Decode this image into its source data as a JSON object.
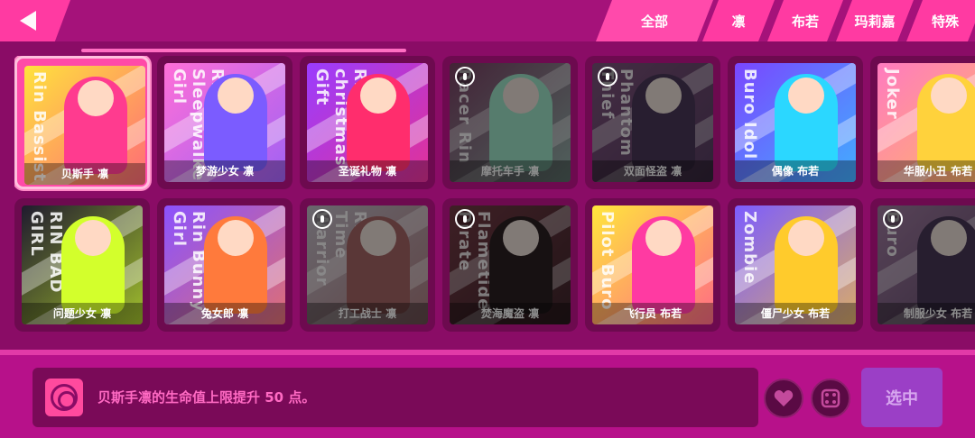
{
  "header": {
    "tabs": [
      {
        "label": "全部",
        "active": true
      },
      {
        "label": "凛"
      },
      {
        "label": "布若"
      },
      {
        "label": "玛莉嘉"
      },
      {
        "label": "特殊"
      }
    ]
  },
  "cards": [
    {
      "name": "贝斯手 凛",
      "art_text": "Rin Bassist",
      "bg": "#ffe23c",
      "accent": "#ff3b8f",
      "locked": false,
      "selected": true
    },
    {
      "name": "梦游少女 凛",
      "art_text": "Rin Sleepwalker Girl",
      "bg": "#ff6fd8",
      "accent": "#7b5cff",
      "locked": false
    },
    {
      "name": "圣诞礼物 凛",
      "art_text": "Rin christmas Gift",
      "bg": "#9a3cff",
      "accent": "#ff2d6d",
      "locked": false
    },
    {
      "name": "摩托车手 凛",
      "art_text": "Racer Rin",
      "bg": "#c9238a",
      "accent": "#3dffb4",
      "locked": true
    },
    {
      "name": "双面怪盗 凛",
      "art_text": "Phantom Thief",
      "bg": "#b53ab0",
      "accent": "#5c2c8a",
      "locked": true
    },
    {
      "name": "偶像 布若",
      "art_text": "Buro Idol",
      "bg": "#7a46ff",
      "accent": "#2bd7ff",
      "locked": false
    },
    {
      "name": "华服小丑 布若",
      "art_text": "Joker",
      "bg": "#ff7ac0",
      "accent": "#ffd23c",
      "locked": false
    },
    {
      "name": "问题少女 凛",
      "art_text": "RIN BAD GIRL",
      "bg": "#1f1a2e",
      "accent": "#d3ff2c",
      "locked": false
    },
    {
      "name": "兔女郎 凛",
      "art_text": "Rin Bunny Girl",
      "bg": "#8b52ff",
      "accent": "#ff7a3c",
      "locked": false
    },
    {
      "name": "打工战士 凛",
      "art_text": "Rin Part-Time Warrior",
      "bg": "#c7b7d8",
      "accent": "#ff4b4b",
      "locked": true
    },
    {
      "name": "焚海魔盗 凛",
      "art_text": "Flametide Pirate",
      "bg": "#c42040",
      "accent": "#3a1a22",
      "locked": true
    },
    {
      "name": "飞行员 布若",
      "art_text": "Pilot Buro",
      "bg": "#ffe63c",
      "accent": "#ff3aa2",
      "locked": false
    },
    {
      "name": "僵尸少女 布若",
      "art_text": "Zombie",
      "bg": "#7c5cff",
      "accent": "#ffcb2c",
      "locked": false
    },
    {
      "name": "制服少女 布若",
      "art_text": "Buro",
      "bg": "#d067d0",
      "accent": "#5b2c86",
      "locked": true
    }
  ],
  "footer": {
    "description": "贝斯手凛的生命值上限提升 50 点。",
    "select_label": "选中",
    "heart_icon": "heart-icon",
    "dice_icon": "dice-icon"
  },
  "colors": {
    "background": "#8a0c66",
    "accent": "#ff3aa2",
    "select_button": "#9b3fc6"
  }
}
